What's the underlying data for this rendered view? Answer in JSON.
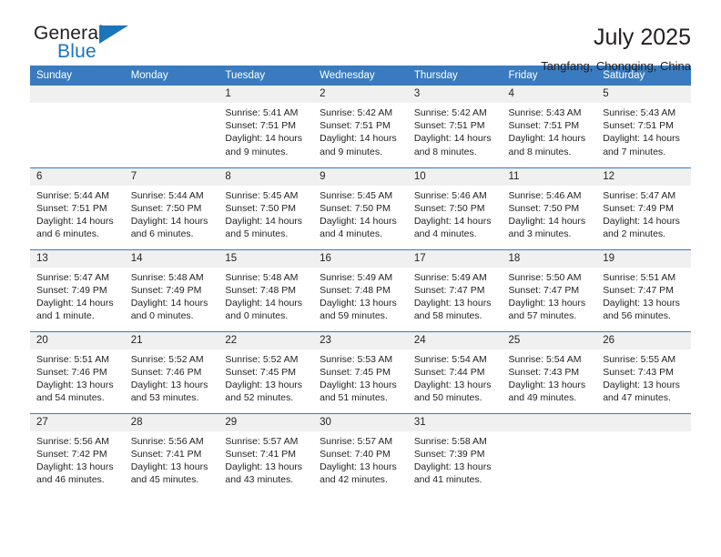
{
  "brand": {
    "name_top": "General",
    "name_bottom": "Blue",
    "triangle_icon": "triangle-icon",
    "accent_color": "#1b75bb"
  },
  "header": {
    "title": "July 2025",
    "subtitle": "Tangfang, Chongqing, China"
  },
  "calendar": {
    "header_bg": "#3a7bbf",
    "daynum_bg": "#f0f0f0",
    "weekday_headers": [
      "Sunday",
      "Monday",
      "Tuesday",
      "Wednesday",
      "Thursday",
      "Friday",
      "Saturday"
    ],
    "weeks": [
      [
        {
          "day": "",
          "sunrise": "",
          "sunset": "",
          "daylight": ""
        },
        {
          "day": "",
          "sunrise": "",
          "sunset": "",
          "daylight": ""
        },
        {
          "day": "1",
          "sunrise": "Sunrise: 5:41 AM",
          "sunset": "Sunset: 7:51 PM",
          "daylight": "Daylight: 14 hours and 9 minutes."
        },
        {
          "day": "2",
          "sunrise": "Sunrise: 5:42 AM",
          "sunset": "Sunset: 7:51 PM",
          "daylight": "Daylight: 14 hours and 9 minutes."
        },
        {
          "day": "3",
          "sunrise": "Sunrise: 5:42 AM",
          "sunset": "Sunset: 7:51 PM",
          "daylight": "Daylight: 14 hours and 8 minutes."
        },
        {
          "day": "4",
          "sunrise": "Sunrise: 5:43 AM",
          "sunset": "Sunset: 7:51 PM",
          "daylight": "Daylight: 14 hours and 8 minutes."
        },
        {
          "day": "5",
          "sunrise": "Sunrise: 5:43 AM",
          "sunset": "Sunset: 7:51 PM",
          "daylight": "Daylight: 14 hours and 7 minutes."
        }
      ],
      [
        {
          "day": "6",
          "sunrise": "Sunrise: 5:44 AM",
          "sunset": "Sunset: 7:51 PM",
          "daylight": "Daylight: 14 hours and 6 minutes."
        },
        {
          "day": "7",
          "sunrise": "Sunrise: 5:44 AM",
          "sunset": "Sunset: 7:50 PM",
          "daylight": "Daylight: 14 hours and 6 minutes."
        },
        {
          "day": "8",
          "sunrise": "Sunrise: 5:45 AM",
          "sunset": "Sunset: 7:50 PM",
          "daylight": "Daylight: 14 hours and 5 minutes."
        },
        {
          "day": "9",
          "sunrise": "Sunrise: 5:45 AM",
          "sunset": "Sunset: 7:50 PM",
          "daylight": "Daylight: 14 hours and 4 minutes."
        },
        {
          "day": "10",
          "sunrise": "Sunrise: 5:46 AM",
          "sunset": "Sunset: 7:50 PM",
          "daylight": "Daylight: 14 hours and 4 minutes."
        },
        {
          "day": "11",
          "sunrise": "Sunrise: 5:46 AM",
          "sunset": "Sunset: 7:50 PM",
          "daylight": "Daylight: 14 hours and 3 minutes."
        },
        {
          "day": "12",
          "sunrise": "Sunrise: 5:47 AM",
          "sunset": "Sunset: 7:49 PM",
          "daylight": "Daylight: 14 hours and 2 minutes."
        }
      ],
      [
        {
          "day": "13",
          "sunrise": "Sunrise: 5:47 AM",
          "sunset": "Sunset: 7:49 PM",
          "daylight": "Daylight: 14 hours and 1 minute."
        },
        {
          "day": "14",
          "sunrise": "Sunrise: 5:48 AM",
          "sunset": "Sunset: 7:49 PM",
          "daylight": "Daylight: 14 hours and 0 minutes."
        },
        {
          "day": "15",
          "sunrise": "Sunrise: 5:48 AM",
          "sunset": "Sunset: 7:48 PM",
          "daylight": "Daylight: 14 hours and 0 minutes."
        },
        {
          "day": "16",
          "sunrise": "Sunrise: 5:49 AM",
          "sunset": "Sunset: 7:48 PM",
          "daylight": "Daylight: 13 hours and 59 minutes."
        },
        {
          "day": "17",
          "sunrise": "Sunrise: 5:49 AM",
          "sunset": "Sunset: 7:47 PM",
          "daylight": "Daylight: 13 hours and 58 minutes."
        },
        {
          "day": "18",
          "sunrise": "Sunrise: 5:50 AM",
          "sunset": "Sunset: 7:47 PM",
          "daylight": "Daylight: 13 hours and 57 minutes."
        },
        {
          "day": "19",
          "sunrise": "Sunrise: 5:51 AM",
          "sunset": "Sunset: 7:47 PM",
          "daylight": "Daylight: 13 hours and 56 minutes."
        }
      ],
      [
        {
          "day": "20",
          "sunrise": "Sunrise: 5:51 AM",
          "sunset": "Sunset: 7:46 PM",
          "daylight": "Daylight: 13 hours and 54 minutes."
        },
        {
          "day": "21",
          "sunrise": "Sunrise: 5:52 AM",
          "sunset": "Sunset: 7:46 PM",
          "daylight": "Daylight: 13 hours and 53 minutes."
        },
        {
          "day": "22",
          "sunrise": "Sunrise: 5:52 AM",
          "sunset": "Sunset: 7:45 PM",
          "daylight": "Daylight: 13 hours and 52 minutes."
        },
        {
          "day": "23",
          "sunrise": "Sunrise: 5:53 AM",
          "sunset": "Sunset: 7:45 PM",
          "daylight": "Daylight: 13 hours and 51 minutes."
        },
        {
          "day": "24",
          "sunrise": "Sunrise: 5:54 AM",
          "sunset": "Sunset: 7:44 PM",
          "daylight": "Daylight: 13 hours and 50 minutes."
        },
        {
          "day": "25",
          "sunrise": "Sunrise: 5:54 AM",
          "sunset": "Sunset: 7:43 PM",
          "daylight": "Daylight: 13 hours and 49 minutes."
        },
        {
          "day": "26",
          "sunrise": "Sunrise: 5:55 AM",
          "sunset": "Sunset: 7:43 PM",
          "daylight": "Daylight: 13 hours and 47 minutes."
        }
      ],
      [
        {
          "day": "27",
          "sunrise": "Sunrise: 5:56 AM",
          "sunset": "Sunset: 7:42 PM",
          "daylight": "Daylight: 13 hours and 46 minutes."
        },
        {
          "day": "28",
          "sunrise": "Sunrise: 5:56 AM",
          "sunset": "Sunset: 7:41 PM",
          "daylight": "Daylight: 13 hours and 45 minutes."
        },
        {
          "day": "29",
          "sunrise": "Sunrise: 5:57 AM",
          "sunset": "Sunset: 7:41 PM",
          "daylight": "Daylight: 13 hours and 43 minutes."
        },
        {
          "day": "30",
          "sunrise": "Sunrise: 5:57 AM",
          "sunset": "Sunset: 7:40 PM",
          "daylight": "Daylight: 13 hours and 42 minutes."
        },
        {
          "day": "31",
          "sunrise": "Sunrise: 5:58 AM",
          "sunset": "Sunset: 7:39 PM",
          "daylight": "Daylight: 13 hours and 41 minutes."
        },
        {
          "day": "",
          "sunrise": "",
          "sunset": "",
          "daylight": ""
        },
        {
          "day": "",
          "sunrise": "",
          "sunset": "",
          "daylight": ""
        }
      ]
    ]
  }
}
